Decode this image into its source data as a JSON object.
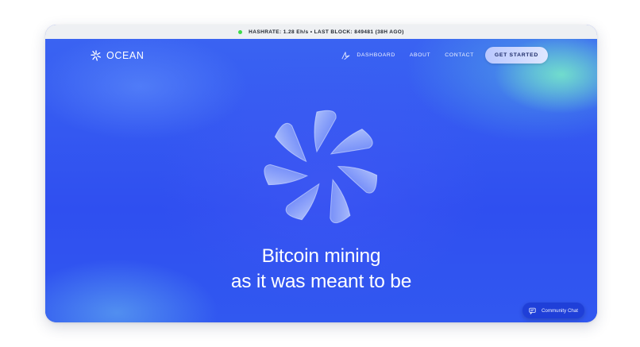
{
  "status_bar": {
    "text": "HASHRATE: 1.28 Eh/s • LAST BLOCK: 849481 (38H AGO)",
    "indicator_color": "#3fd94a"
  },
  "header": {
    "logo_text": "OCEAN",
    "logo_icon": "ocean-flower-icon",
    "nav_icon": "sparkle-icon",
    "nav": {
      "dashboard": "DASHBOARD",
      "about": "ABOUT",
      "contact": "CONTACT",
      "cta": "GET STARTED"
    }
  },
  "hero": {
    "line1": "Bitcoin mining",
    "line2": "as it was meant to be",
    "emblem_icon": "ocean-flower-icon"
  },
  "chat": {
    "label": "Community Chat",
    "icon": "chat-bubble-icon"
  },
  "colors": {
    "background": "#3155ee",
    "accent": "#78ebc8",
    "cta_bg": "#c9d5ff",
    "chat_bg": "#1f3fd8"
  }
}
